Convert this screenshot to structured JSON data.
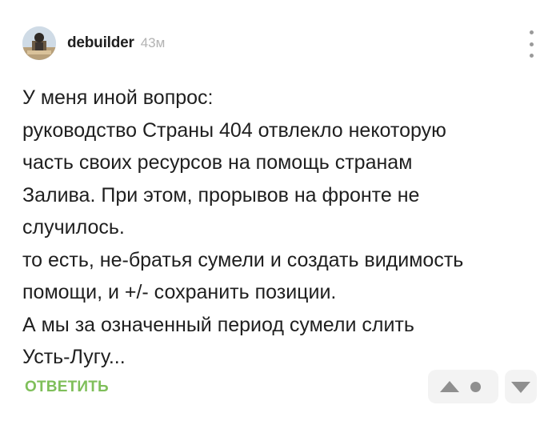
{
  "comment": {
    "author": "debuilder",
    "time": "43м",
    "lines": [
      "У меня иной вопрос:",
      "руководство Страны 404 отвлекло некоторую",
      "часть своих ресурсов на помощь странам",
      "Залива. При этом, прорывов на фронте не",
      "случилось.",
      "то есть, не-братья сумели и создать видимость",
      "помощи, и +/- сохранить позиции.",
      "А мы за означенный период сумели слить",
      "Усть-Лугу..."
    ],
    "reply_label": "ОТВЕТИТЬ"
  },
  "icons": {
    "avatar": "avatar-image",
    "more": "kebab-menu-icon",
    "up": "triangle-up-icon",
    "rating": "neutral-dot-icon",
    "down": "triangle-down-icon"
  },
  "colors": {
    "reply": "#7fbf5a",
    "time": "#b3b3b3",
    "icon": "#8f8f8f",
    "rating_bg": "#f3f3f3"
  }
}
